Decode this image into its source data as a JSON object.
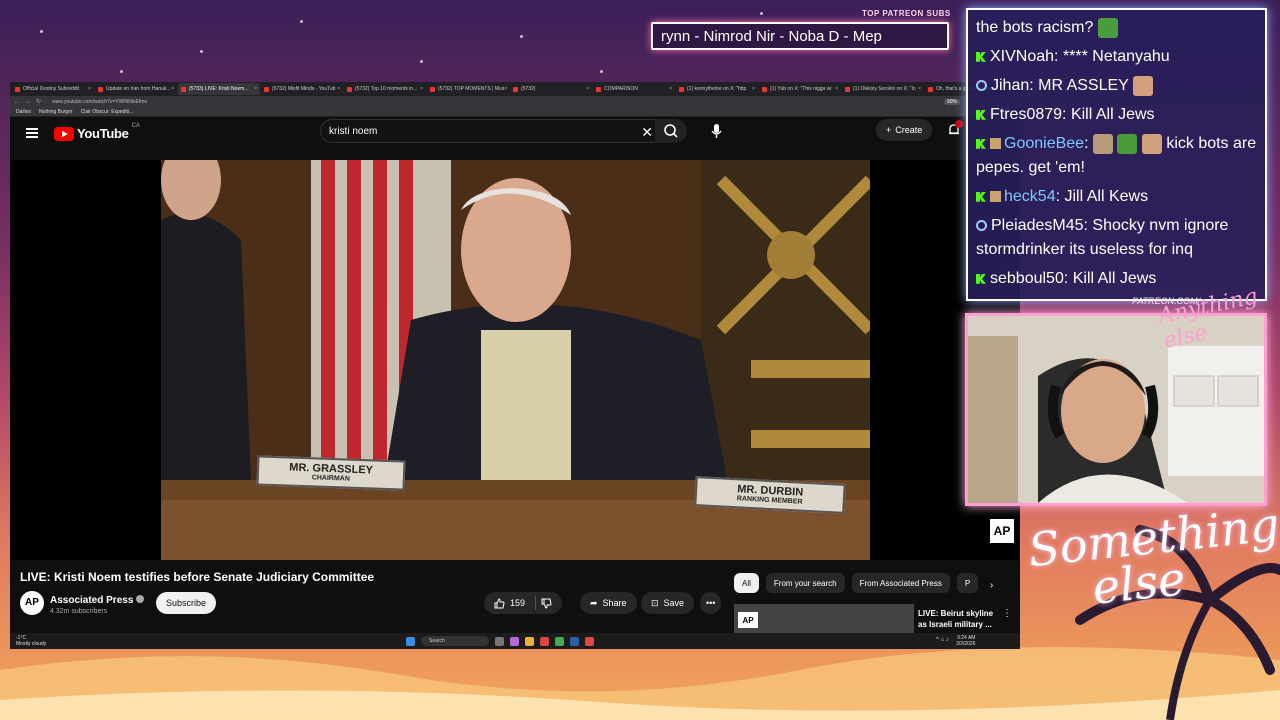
{
  "stream": {
    "ticker_label": "TOP PATREON SUBS",
    "ticker_text": "rynn - Nimrod Nir - Noba D - Mep",
    "brand_small": "PATREON.COM/",
    "brand_script": "Anything else",
    "logo_text_1": "Something",
    "logo_text_2": "else",
    "ap_badge": "AP"
  },
  "browser": {
    "tabs": [
      {
        "label": "Official Destiny Subreddit",
        "active": false
      },
      {
        "label": "Update on Iran from Hanuk...",
        "active": false
      },
      {
        "label": "(5733) LIVE: Kristi Noem...",
        "active": true
      },
      {
        "label": "(5732) Misfit Minds - YouTub",
        "active": false
      },
      {
        "label": "(5732) Top 10 moments in...",
        "active": false
      },
      {
        "label": "(5732) TOP MOMENTS | Mus",
        "active": false
      },
      {
        "label": "(5732)",
        "active": false
      },
      {
        "label": "COMPARISON",
        "active": false
      },
      {
        "label": "(1) kennythetoe on X: \"http",
        "active": false
      },
      {
        "label": "(1) Yub on X: \"This nigga wi",
        "active": false
      },
      {
        "label": "(1) Oleksiy Sorokin on X: \"In",
        "active": false
      },
      {
        "label": "Oh, that's a groyper post, is",
        "active": false
      }
    ],
    "url": "www.youtube.com/watch?v=YWRtNlxEfmo",
    "zoom": "90%",
    "bookmarks": [
      "Dailies",
      "Nothing Burger",
      "Clair Obscur: Expediti..."
    ]
  },
  "youtube": {
    "logo_text": "YouTube",
    "country": "CA",
    "search_value": "kristi noem",
    "create_label": "Create",
    "video_title": "LIVE: Kristi Noem testifies before Senate Judiciary Committee",
    "channel_avatar": "AP",
    "channel_name": "Associated Press",
    "subscribers": "4.32m subscribers",
    "subscribe_label": "Subscribe",
    "like_count": "159",
    "share_label": "Share",
    "save_label": "Save",
    "chips": [
      "All",
      "From your search",
      "From Associated Press",
      "P"
    ],
    "rec": {
      "thumb_badge": "AP",
      "title": "LIVE: Beirut skyline as Israeli military ..."
    },
    "nameplates": {
      "left_name": "MR. GRASSLEY",
      "left_title": "CHAIRMAN",
      "right_name": "MR. DURBIN",
      "right_title": "RANKING MEMBER"
    }
  },
  "taskbar": {
    "weather_temp": "-1°C",
    "weather_desc": "Mostly cloudy",
    "search_label": "Search",
    "time": "9:24 AM",
    "date": "3/3/2026"
  },
  "chat": {
    "messages": [
      {
        "badge": "none",
        "user": "",
        "text": "the bots racism?",
        "emote": "pepe"
      },
      {
        "badge": "kick",
        "user": "XIVNoah",
        "text": "**** Netanyahu",
        "emote": ""
      },
      {
        "badge": "twitch",
        "user": "Jihan",
        "text": "MR ASSLEY",
        "emote": "face"
      },
      {
        "badge": "kick",
        "user": "Ftres0879",
        "text": "Kill All Jews",
        "emote": ""
      },
      {
        "badge": "kick",
        "user": "GoonieBee",
        "text": "kick bots are pepes. get 'em!",
        "emote": "multi"
      },
      {
        "badge": "kick",
        "user": "heck54",
        "text": "Jill All Kews",
        "emote": ""
      },
      {
        "badge": "twitch",
        "user": "PleiadesM45",
        "text": "Shocky nvm ignore stormdrinker its useless for inq",
        "emote": ""
      },
      {
        "badge": "kick",
        "user": "sebboul50",
        "text": "Kill All Jews",
        "emote": ""
      }
    ]
  },
  "colors": {
    "yt_red": "#ff0000",
    "kick_green": "#53fc18",
    "chat_border": "#ffffff",
    "cam_border": "#ff9ed1",
    "goonie_name": "#7fc8ff",
    "heck_name": "#7fc8ff"
  }
}
